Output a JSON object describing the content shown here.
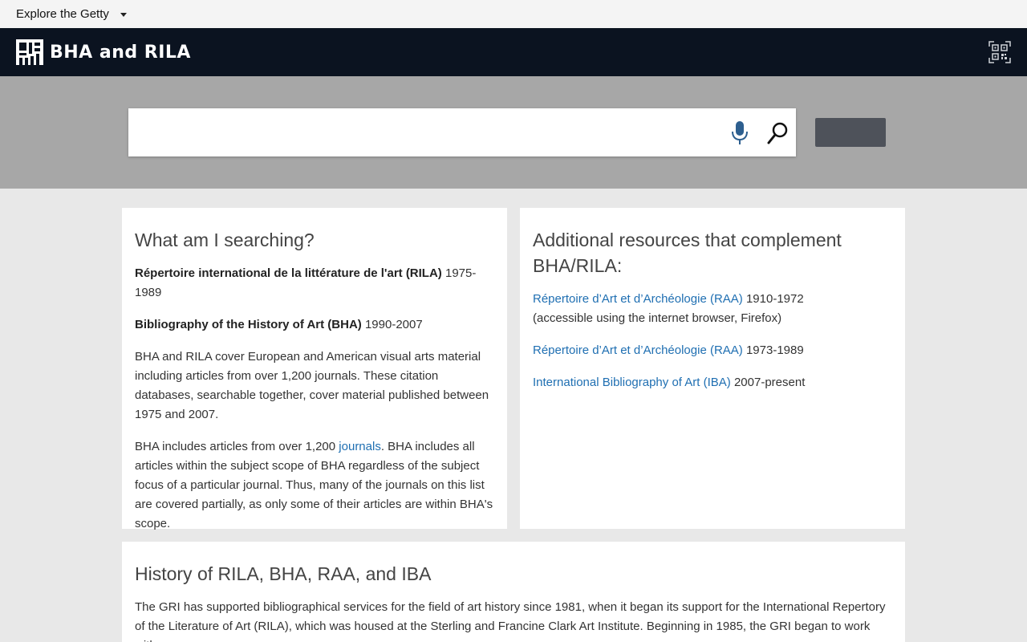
{
  "explore": {
    "label": "Explore the Getty"
  },
  "brand": {
    "title": "BHA and RILA"
  },
  "search": {
    "placeholder": ""
  },
  "colors": {
    "brand_bar": "#0b1320",
    "search_band": "#a7a7a7",
    "link": "#1f6fb2",
    "side_button": "#4e525a"
  },
  "left_card": {
    "title": "What am I searching?",
    "rila_name": "Répertoire international de la littérature de l'art (RILA)",
    "rila_years": " 1975-1989",
    "bha_name": "Bibliography of the History of Art (BHA)",
    "bha_years": " 1990-2007",
    "description": "BHA and RILA cover European and American visual arts material including articles from over 1,200 journals. These citation databases, searchable together, cover material published between 1975 and 2007.",
    "journals_pre": "BHA includes articles from over 1,200 ",
    "journals_link": "journals",
    "journals_post": ". BHA includes all articles within the subject scope of BHA regardless of the subject focus of a particular journal. Thus, many of the journals on this list are covered partially, as only some of their articles are within BHA's scope."
  },
  "right_card": {
    "title": "Additional resources that complement BHA/RILA:",
    "resources": [
      {
        "link": "Répertoire d’Art et d’Archéologie (RAA)",
        "years": " 1910-1972",
        "note": "(accessible using the internet browser, Firefox)"
      },
      {
        "link": "Répertoire d’Art et d’Archéologie (RAA)",
        "years": " 1973-1989"
      },
      {
        "link": "International Bibliography of Art (IBA)",
        "years": " 2007-present"
      }
    ]
  },
  "bottom_card": {
    "title": "History of RILA, BHA, RAA, and IBA",
    "text": "The GRI has supported bibliographical services for the field of art history since 1981, when it began its support for the International Repertory of the Literature of Art (RILA), which was housed at the Sterling and Francine Clark Art Institute. Beginning in 1985, the GRI began to work with"
  }
}
